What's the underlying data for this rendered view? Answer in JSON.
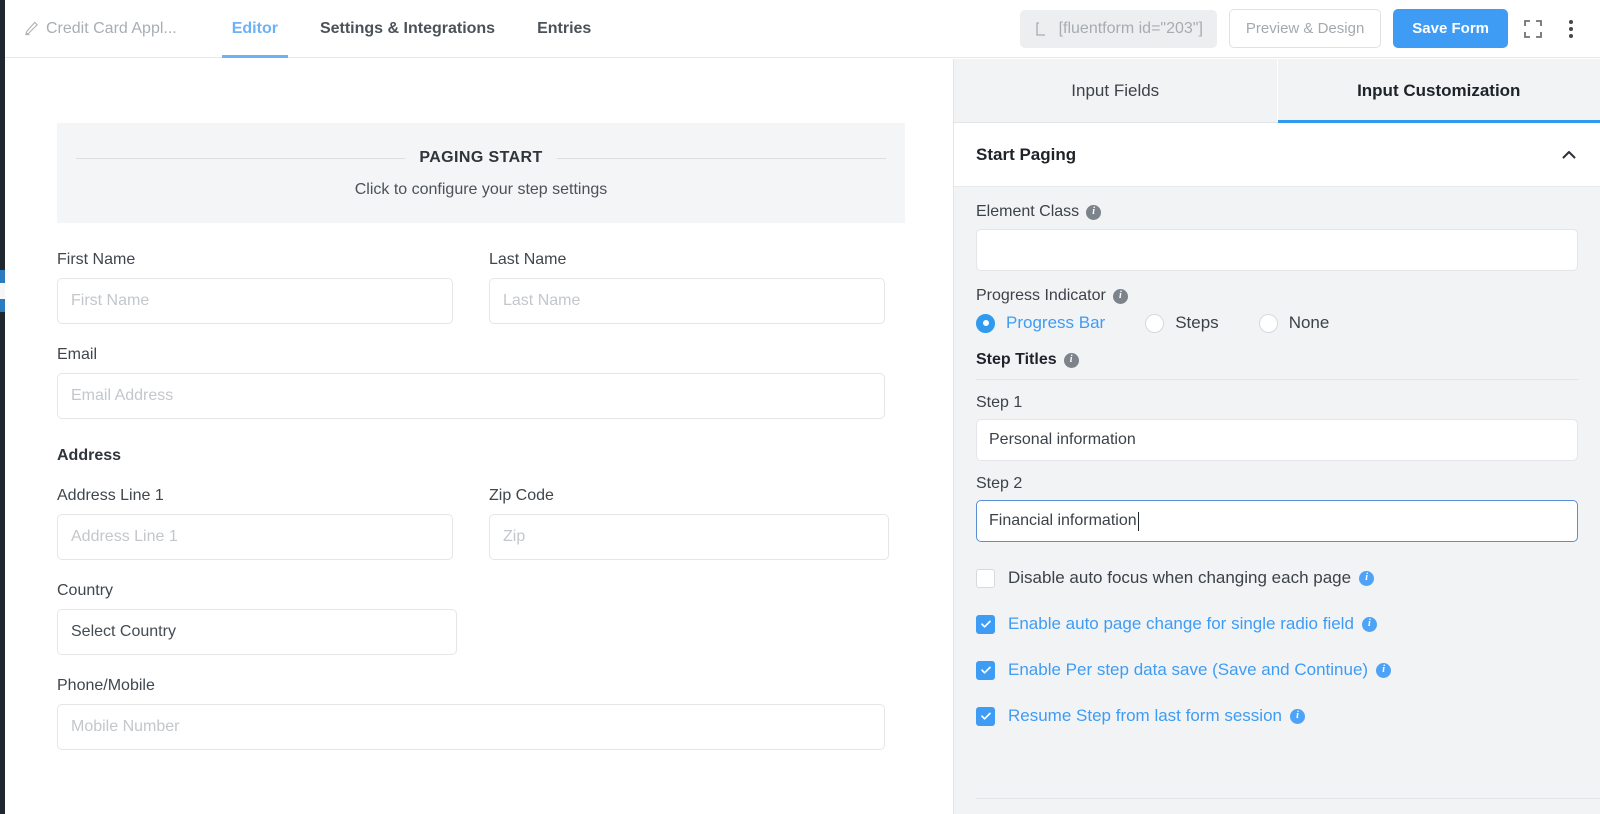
{
  "header": {
    "form_title": "Credit Card Appl...",
    "pencil_icon": "pencil-icon",
    "tabs": [
      {
        "label": "Editor",
        "active": true
      },
      {
        "label": "Settings & Integrations",
        "active": false
      },
      {
        "label": "Entries",
        "active": false
      }
    ],
    "shortcode": "[fluentform id=\"203\"]",
    "shortcode_icon": "shortcode-bracket-icon",
    "preview_button": "Preview & Design",
    "save_button": "Save Form",
    "fullscreen_icon": "fullscreen-icon",
    "more_icon": "kebab-menu-icon",
    "accent_color": "#3e9cf5"
  },
  "canvas": {
    "paging_start": {
      "title": "PAGING START",
      "subtitle": "Click to configure your step settings"
    },
    "fields": {
      "first_name": {
        "label": "First Name",
        "placeholder": "First Name"
      },
      "last_name": {
        "label": "Last Name",
        "placeholder": "Last Name"
      },
      "email": {
        "label": "Email",
        "placeholder": "Email Address"
      },
      "address_section": "Address",
      "address_line_1": {
        "label": "Address Line 1",
        "placeholder": "Address Line 1"
      },
      "zip_code": {
        "label": "Zip Code",
        "placeholder": "Zip"
      },
      "country": {
        "label": "Country",
        "value": "Select Country"
      },
      "phone": {
        "label": "Phone/Mobile",
        "placeholder": "Mobile Number"
      }
    }
  },
  "panel": {
    "tabs": [
      {
        "label": "Input Fields",
        "active": false
      },
      {
        "label": "Input Customization",
        "active": true
      }
    ],
    "section_title": "Start Paging",
    "collapse_icon": "chevron-up-icon",
    "element_class": {
      "label": "Element Class",
      "value": "",
      "info_icon": "info-icon"
    },
    "progress_indicator": {
      "label": "Progress Indicator",
      "info_icon": "info-icon",
      "options": [
        {
          "label": "Progress Bar",
          "selected": true
        },
        {
          "label": "Steps",
          "selected": false
        },
        {
          "label": "None",
          "selected": false
        }
      ]
    },
    "step_titles": {
      "label": "Step Titles",
      "info_icon": "info-icon",
      "steps": [
        {
          "label": "Step 1",
          "value": "Personal information",
          "focused": false
        },
        {
          "label": "Step 2",
          "value": "Financial information",
          "focused": true
        }
      ]
    },
    "checkboxes": [
      {
        "label": "Disable auto focus when changing each page",
        "checked": false,
        "info_icon": "info-icon"
      },
      {
        "label": "Enable auto page change for single radio field",
        "checked": true,
        "info_icon": "info-icon"
      },
      {
        "label": "Enable Per step data save (Save and Continue)",
        "checked": true,
        "info_icon": "info-icon"
      },
      {
        "label": "Resume Step from last form session",
        "checked": true,
        "info_icon": "info-icon"
      }
    ]
  }
}
